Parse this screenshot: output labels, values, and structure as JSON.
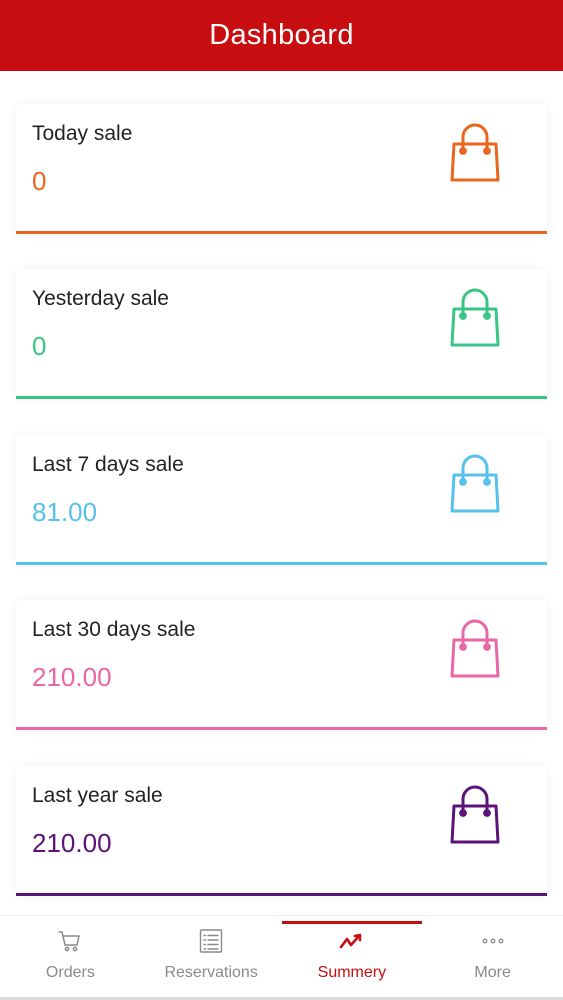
{
  "header": {
    "title": "Dashboard"
  },
  "cards": [
    {
      "label": "Today sale",
      "value": "0",
      "color": "#e8661e",
      "icon": "shopping-bag-icon"
    },
    {
      "label": "Yesterday sale",
      "value": "0",
      "color": "#38c585",
      "icon": "shopping-bag-icon"
    },
    {
      "label": "Last 7 days sale",
      "value": "81.00",
      "color": "#56c2ec",
      "icon": "shopping-bag-icon"
    },
    {
      "label": "Last 30 days sale",
      "value": "210.00",
      "color": "#e867a6",
      "icon": "shopping-bag-icon"
    },
    {
      "label": "Last year sale",
      "value": "210.00",
      "color": "#5b137a",
      "icon": "shopping-bag-icon"
    }
  ],
  "nav": {
    "items": [
      {
        "label": "Orders",
        "icon": "cart-icon",
        "active": false
      },
      {
        "label": "Reservations",
        "icon": "list-icon",
        "active": false
      },
      {
        "label": "Summery",
        "icon": "trend-chart-icon",
        "active": true
      },
      {
        "label": "More",
        "icon": "more-dots-icon",
        "active": false
      }
    ],
    "active_color": "#c80d10",
    "inactive_color": "#8a8a8a"
  },
  "theme": {
    "brand": "#c80d10"
  }
}
